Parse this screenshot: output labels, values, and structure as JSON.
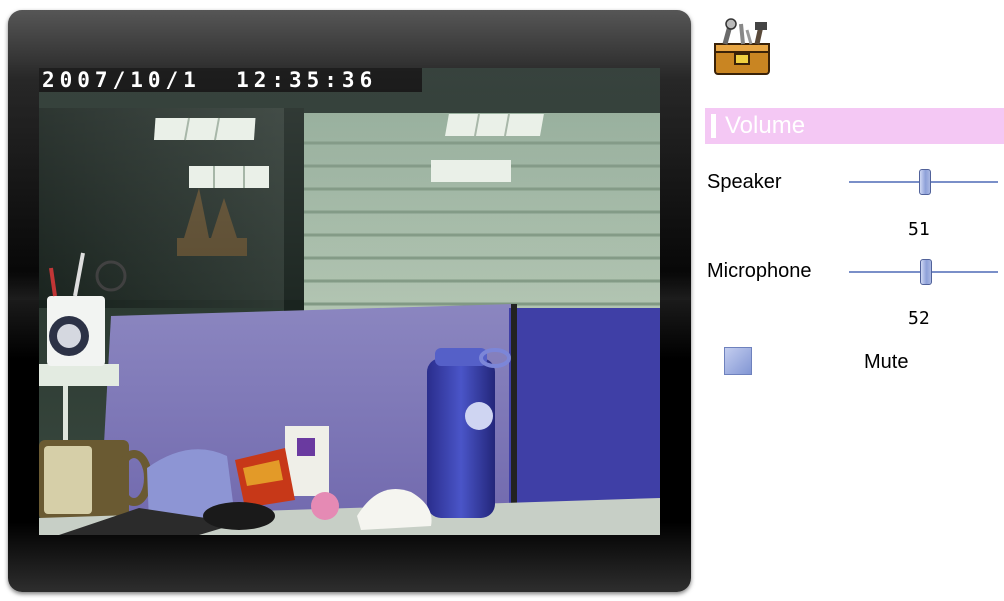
{
  "video": {
    "timestamp": "2007/10/1  12:35:36"
  },
  "toolbox": {
    "icon": "toolbox-icon"
  },
  "volume": {
    "title": "Volume",
    "speaker": {
      "label": "Speaker",
      "value": 51
    },
    "microphone": {
      "label": "Microphone",
      "value": 52
    },
    "mute": {
      "label": "Mute",
      "checked": false
    }
  },
  "colors": {
    "header_bg": "#f4c8f4",
    "slider_track": "#7a8fc8",
    "slider_thumb": "#8da0d8"
  }
}
